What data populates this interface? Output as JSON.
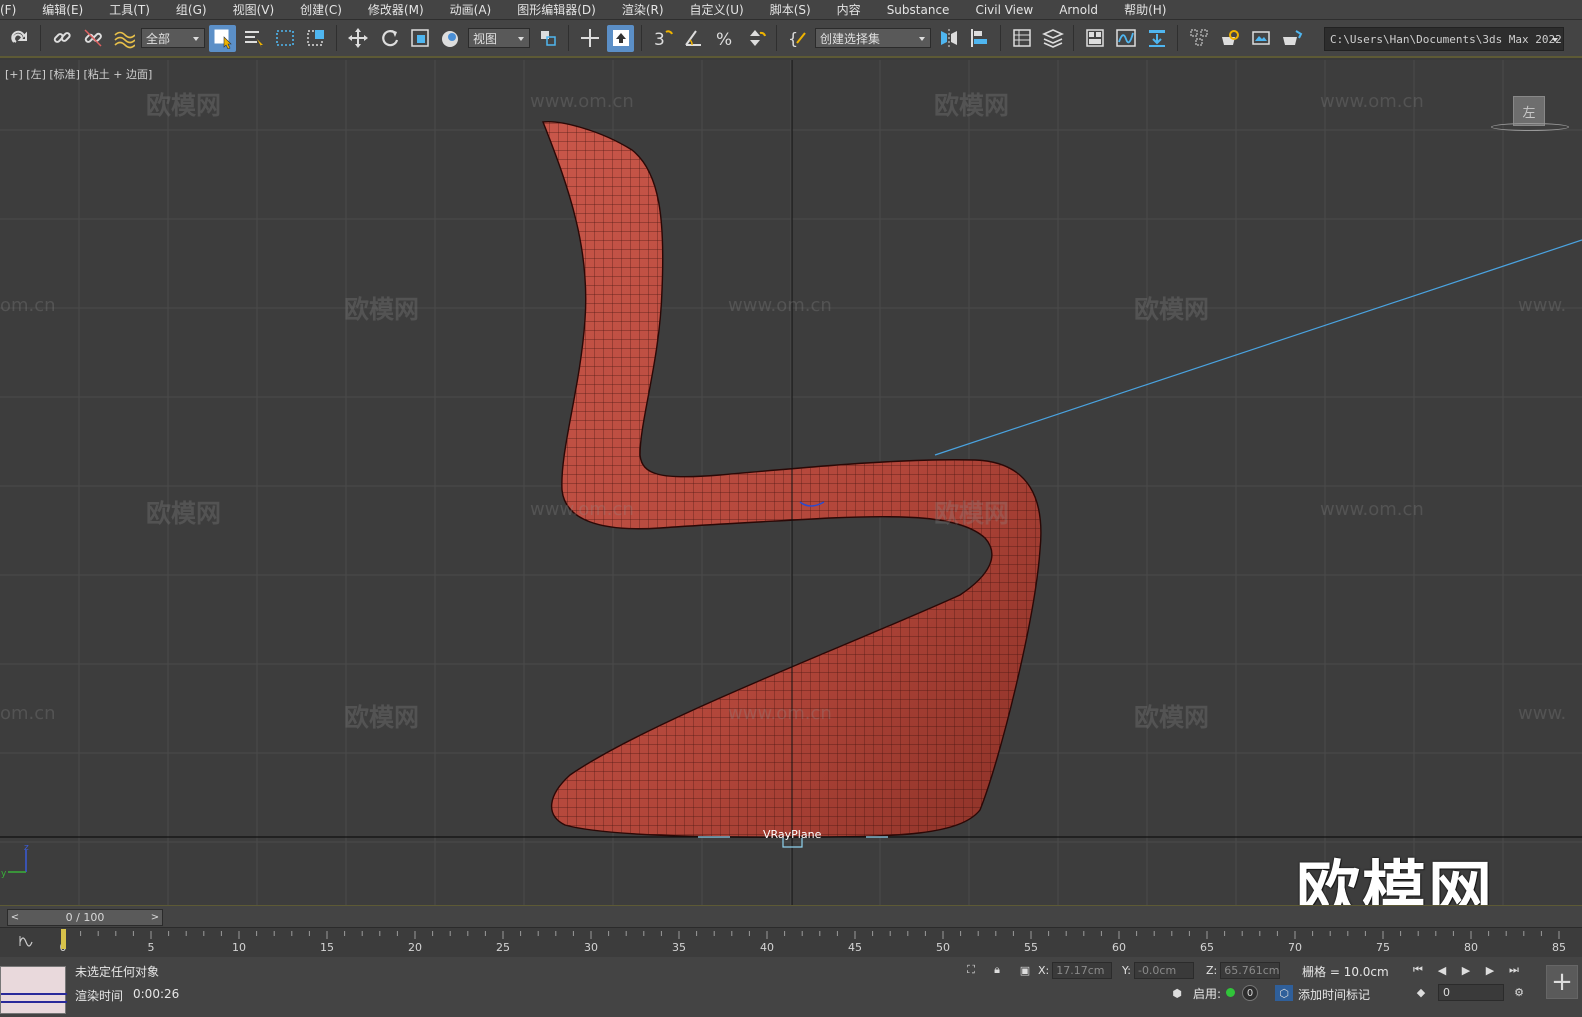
{
  "menu": [
    "(F)",
    "编辑(E)",
    "工具(T)",
    "组(G)",
    "视图(V)",
    "创建(C)",
    "修改器(M)",
    "动画(A)",
    "图形编辑器(D)",
    "渲染(R)",
    "自定义(U)",
    "脚本(S)",
    "内容",
    "Substance",
    "Civil View",
    "Arnold",
    "帮助(H)"
  ],
  "toolbar": {
    "selection_filter": "全部",
    "reference_coord": "视图",
    "named_selection": "创建选择集",
    "project_path": "C:\\Users\\Han\\Documents\\3ds Max 2022"
  },
  "viewport": {
    "label": "[+] [左] [标准] [粘土 + 边面]",
    "viewcube_face": "左",
    "object_label": "VRayPlane",
    "watermark_text": "欧模网",
    "watermark_url": "www.om.cn",
    "watermark_url_partial": "om.cn",
    "watermark_url_edge": "www.",
    "brand_watermark": "欧模网",
    "axis": {
      "z": "z",
      "y": "y"
    },
    "colors": {
      "chair": "#b9473a",
      "mesh_lines": "#3a0f0b",
      "bg": "#3d3d3d",
      "grid": "#4a4a4a",
      "highlight_line": "#4aa3e0"
    }
  },
  "timeline": {
    "frame_display": "0 / 100",
    "prev": "<",
    "next": ">",
    "ticks": [
      "0",
      "5",
      "10",
      "15",
      "20",
      "25",
      "30",
      "35",
      "40",
      "45",
      "50",
      "55",
      "60",
      "65",
      "70",
      "75",
      "80",
      "85"
    ]
  },
  "status": {
    "selection_msg": "未选定任何对象",
    "render_time_label": "渲染时间",
    "render_time_value": "0:00:26",
    "x_label": "X:",
    "x_value": "17.17cm",
    "y_label": "Y:",
    "y_value": "-0.0cm",
    "z_label": "Z:",
    "z_value": "65.761cm",
    "grid_text": "栅格 = 10.0cm",
    "enable_label": "启用:",
    "enable_count": "0",
    "add_time_tag": "添加时间标记",
    "current_frame": "0"
  }
}
